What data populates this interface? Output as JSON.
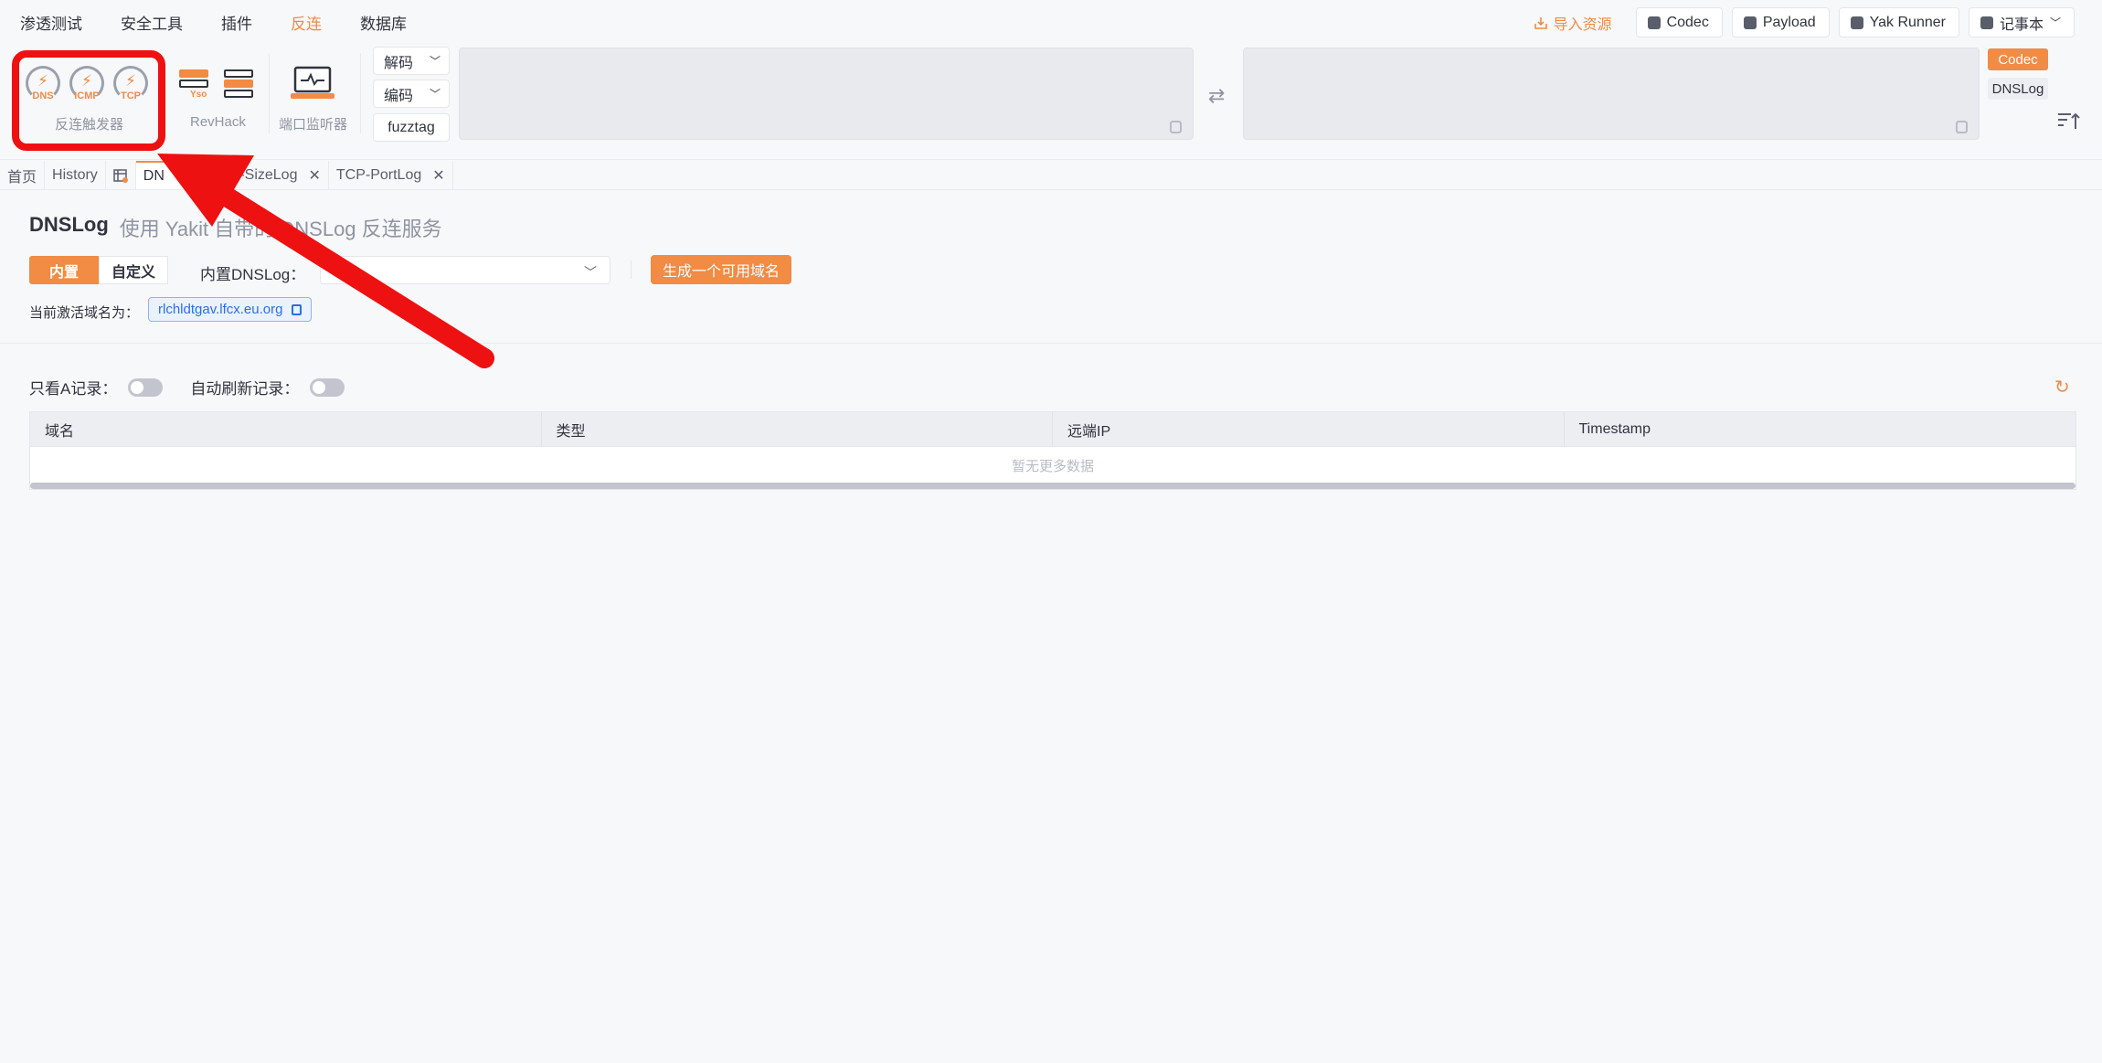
{
  "menu": {
    "items": [
      "渗透测试",
      "安全工具",
      "插件",
      "反连",
      "数据库"
    ],
    "active_index": 3
  },
  "top_right": {
    "import_label": "导入资源",
    "codec_label": "Codec",
    "payload_label": "Payload",
    "yakrunner_label": "Yak Runner",
    "notebook_label": "记事本"
  },
  "toolbar": {
    "gauges": [
      "DNS",
      "ICMP",
      "TCP"
    ],
    "trigger_label": "反连触发器",
    "revhack_label": "RevHack",
    "yso_label": "Yso",
    "port_label": "端口监听器",
    "decode_label": "解码",
    "encode_label": "编码",
    "fuzztag_label": "fuzztag",
    "side_codec": "Codec",
    "side_dnslog": "DNSLog"
  },
  "tabs": {
    "home": "首页",
    "history": "History",
    "active": "DN",
    "icmp": "ICMP-SizeLog",
    "tcp": "TCP-PortLog"
  },
  "dnslog": {
    "title": "DNSLog",
    "subtitle": "使用 Yakit 自带的 DNSLog 反连服务",
    "seg_builtin": "内置",
    "seg_custom": "自定义",
    "select_label": "内置DNSLog：",
    "select_value": "",
    "generate_button": "生成一个可用域名",
    "active_domain_label": "当前激活域名为：",
    "active_domain": "rlchldtgav.lfcx.eu.org",
    "only_a_label": "只看A记录：",
    "auto_refresh_label": "自动刷新记录：",
    "columns": [
      "域名",
      "类型",
      "远端IP",
      "Timestamp"
    ],
    "empty_text": "暂无更多数据"
  },
  "colors": {
    "accent": "#f28b44",
    "highlight": "#ee1111"
  }
}
